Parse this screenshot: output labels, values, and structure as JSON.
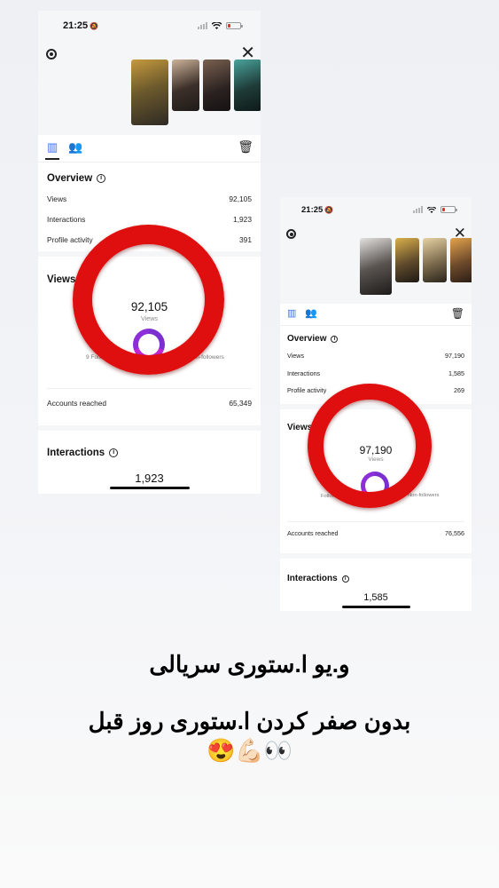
{
  "screen1": {
    "status_time": "21:25",
    "overview_title": "Overview",
    "overview_rows": [
      {
        "label": "Views",
        "value": "92,105"
      },
      {
        "label": "Interactions",
        "value": "1,923"
      },
      {
        "label": "Profile activity",
        "value": "391"
      }
    ],
    "views_title": "Views",
    "views_total": "92,105",
    "views_sub": "Views",
    "legend_left": "9 Follow",
    "legend_right": "Non-followers",
    "accounts_reached_label": "Accounts reached",
    "accounts_reached_value": "65,349",
    "interactions_title": "Interactions",
    "interactions_total": "1,923"
  },
  "screen2": {
    "status_time": "21:25",
    "overview_title": "Overview",
    "overview_rows": [
      {
        "label": "Views",
        "value": "97,190"
      },
      {
        "label": "Interactions",
        "value": "1,585"
      },
      {
        "label": "Profile activity",
        "value": "269"
      }
    ],
    "views_title": "Views",
    "views_total": "97,190",
    "views_sub": "Views",
    "legend_left": "Follow",
    "legend_right_pct": ".1%",
    "legend_right": "Non-followers",
    "accounts_reached_label": "Accounts reached",
    "accounts_reached_value": "76,556",
    "interactions_title": "Interactions",
    "interactions_total": "1,585"
  },
  "caption": {
    "line1": "و.یو ا.ستوری سریالی",
    "line2": "بدون صفر کردن ا.ستوری روز قبل",
    "emojis": "😍💪🏻👀"
  },
  "colors": {
    "ring": "#e00f0f",
    "accent_blue": "#3a6df0",
    "donut_purple": "#7b2fd1",
    "donut_magenta": "#c026d3"
  }
}
